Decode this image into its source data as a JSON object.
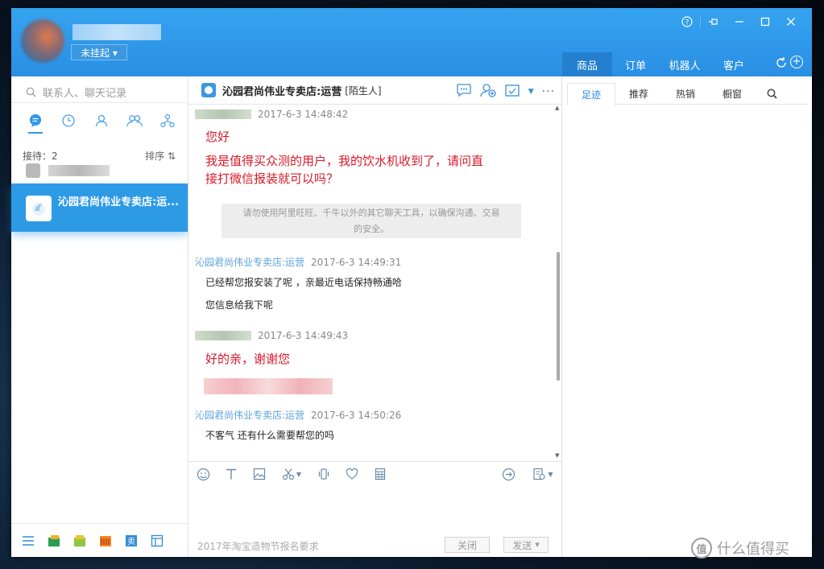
{
  "app": {
    "status_label": "未挂起 ▾",
    "window_controls": [
      "?",
      "⊣",
      "—",
      "☐",
      "✕"
    ]
  },
  "top_tabs": [
    {
      "label": "商品",
      "active": true
    },
    {
      "label": "订单",
      "active": false
    },
    {
      "label": "机器人",
      "active": false
    },
    {
      "label": "客户",
      "active": false
    }
  ],
  "left": {
    "search_placeholder": "联系人、聊天记录",
    "reception_count": "接待：2",
    "sort_label": "排序 ⇅",
    "active_contact_name": "沁园君尚伟业专卖店:运..."
  },
  "chat": {
    "title": "沁园君尚伟业专卖店:运营",
    "stranger_tag": "[陌生人]",
    "messages": {
      "m1_time": "2017-6-3 14:48:42",
      "m1_line1": "您好",
      "m1_line2": "我是值得买众测的用户，我的饮水机收到了，请问直",
      "m1_line3": "接打微信报装就可以吗？",
      "notice_line1": "请勿使用阿里旺旺、千牛以外的其它聊天工具，以确保沟通、交易",
      "notice_line2": "的安全。",
      "m2_sender": "沁园君尚伟业专卖店:运营",
      "m2_time": "2017-6-3 14:49:31",
      "m2_line1": "已经帮您报安装了呢 ，亲最近电话保持畅通哈",
      "m2_line2": "您信息给我下呢",
      "m3_time": "2017-6-3 14:49:43",
      "m3_line1": "好的亲，谢谢您",
      "m4_sender": "沁园君尚伟业专卖店:运营",
      "m4_time": "2017-6-3 14:50:26",
      "m4_line1": "不客气  还有什么需要帮您的吗"
    },
    "hint_text": "2017年淘宝造物节报名要求",
    "close_label": "关闭",
    "send_label": "发送"
  },
  "right": {
    "tabs": [
      {
        "label": "足迹",
        "active": true
      },
      {
        "label": "推荐",
        "active": false
      },
      {
        "label": "热销",
        "active": false
      },
      {
        "label": "橱窗",
        "active": false
      }
    ]
  },
  "watermark": {
    "logo_text": "值",
    "text": "什么值得买"
  },
  "colors": {
    "titlebar": "#2a8fe4",
    "active_contact": "#2d9ae6",
    "customer_text": "#d7192a",
    "shop_name": "#5da3de"
  }
}
